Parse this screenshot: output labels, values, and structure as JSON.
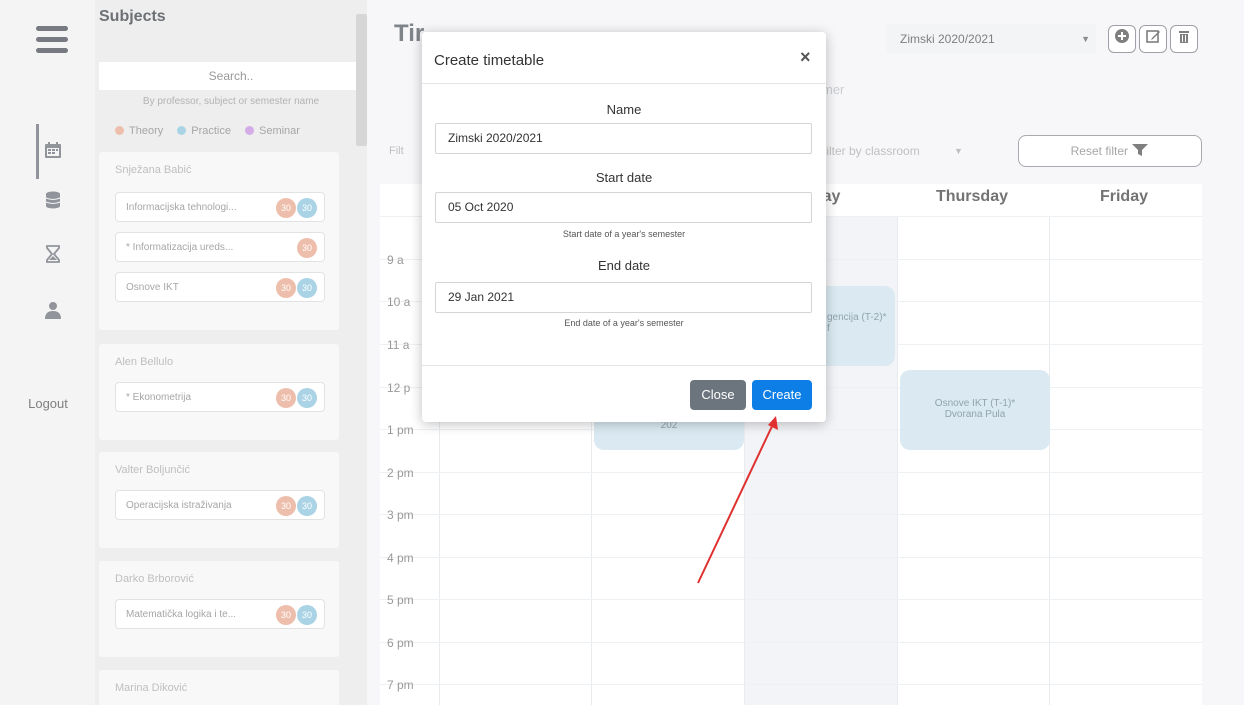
{
  "nav": {
    "logout_label": "Logout",
    "icons": [
      "hamburger-icon",
      "calendar-icon",
      "database-icon",
      "hourglass-icon",
      "user-icon"
    ]
  },
  "subjects": {
    "title": "Subjects",
    "search_placeholder": "Search..",
    "hint": "By professor, subject or semester name",
    "legend": {
      "theory": "Theory",
      "practice": "Practice",
      "seminar": "Seminar",
      "colors": {
        "theory": "#e9a990",
        "practice": "#8ec5dc",
        "seminar": "#c490e0"
      }
    },
    "professors": [
      {
        "name": "Snježana Babić",
        "subjects": [
          {
            "label": "Informacijska tehnologi...",
            "b1": "30",
            "b2": "30"
          },
          {
            "label": "* Informatizacija ureds...",
            "b1": "30",
            "b2": ""
          },
          {
            "label": "Osnove IKT",
            "b1": "30",
            "b2": "30"
          }
        ]
      },
      {
        "name": "Alen Bellulo",
        "subjects": [
          {
            "label": "* Ekonometrija",
            "b1": "30",
            "b2": "30"
          }
        ]
      },
      {
        "name": "Valter Boljunčić",
        "subjects": [
          {
            "label": "Operacijska istraživanja",
            "b1": "30",
            "b2": "30"
          }
        ]
      },
      {
        "name": "Darko Brborović",
        "subjects": [
          {
            "label": "Matematička logika i te...",
            "b1": "30",
            "b2": "30"
          }
        ]
      },
      {
        "name": "Marina Diković",
        "subjects": []
      }
    ]
  },
  "main": {
    "title": "Tir",
    "timetable_select": "Zimski 2020/2021",
    "semester_tab": "mer",
    "filter_left": "Filt",
    "filter_classroom": "Filter by classroom",
    "reset_filter": "Reset filter",
    "days": [
      "esday",
      "Thursday",
      "Friday"
    ],
    "times": [
      "9 a",
      "10 a",
      "11 a",
      "12 p",
      "1 pm",
      "2 pm",
      "3 pm",
      "4 pm",
      "5 pm",
      "6 pm",
      "7 pm"
    ],
    "events": [
      {
        "line1": "gencija (T-2)*",
        "line2": "f"
      },
      {
        "line1": "202",
        "line2": ""
      },
      {
        "line1": "Osnove IKT (T-1)*",
        "line2": "Dvorana Pula"
      }
    ]
  },
  "modal": {
    "title": "Create timetable",
    "close_symbol": "×",
    "name_label": "Name",
    "name_value": "Zimski 2020/2021",
    "start_label": "Start date",
    "start_value": "05 Oct 2020",
    "start_help": "Start date of a year's semester",
    "end_label": "End date",
    "end_value": "29 Jan 2021",
    "end_help": "End date of a year's semester",
    "close_button": "Close",
    "create_button": "Create",
    "colors": {
      "primary": "#0d7ee6",
      "secondary": "#6c757d"
    }
  }
}
